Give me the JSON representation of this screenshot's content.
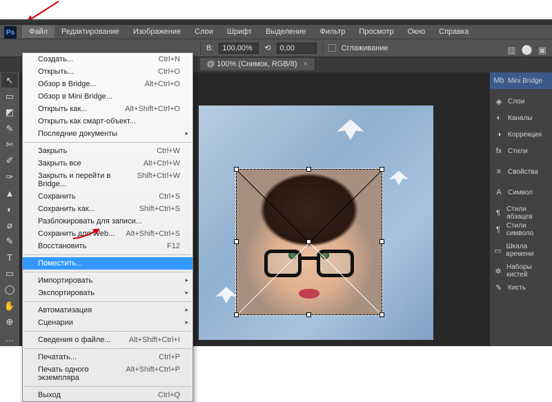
{
  "app_logo": "Ps",
  "menubar": [
    "Файл",
    "Редактирование",
    "Изображение",
    "Слои",
    "Шрифт",
    "Выделение",
    "Фильтр",
    "Просмотр",
    "Окно",
    "Справка"
  ],
  "options": {
    "w_label": "В:",
    "w_value": "100,00%",
    "h_value": "0,00",
    "rot_icon": "⟲",
    "aa_label": "Сглаживание"
  },
  "doc_tab": "@ 100% (Снимок, RGB/8)",
  "dropdown": {
    "groups": [
      [
        {
          "label": "Создать...",
          "shortcut": "Ctrl+N"
        },
        {
          "label": "Открыть...",
          "shortcut": "Ctrl+O"
        },
        {
          "label": "Обзор в Bridge...",
          "shortcut": "Alt+Ctrl+O"
        },
        {
          "label": "Обзор в Mini Bridge..."
        },
        {
          "label": "Открыть как...",
          "shortcut": "Alt+Shift+Ctrl+O"
        },
        {
          "label": "Открыть как смарт-объект..."
        },
        {
          "label": "Последние документы",
          "sub": true
        }
      ],
      [
        {
          "label": "Закрыть",
          "shortcut": "Ctrl+W"
        },
        {
          "label": "Закрыть все",
          "shortcut": "Alt+Ctrl+W"
        },
        {
          "label": "Закрыть и перейти в Bridge...",
          "shortcut": "Shift+Ctrl+W"
        },
        {
          "label": "Сохранить",
          "shortcut": "Ctrl+S"
        },
        {
          "label": "Сохранить как...",
          "shortcut": "Shift+Ctrl+S"
        },
        {
          "label": "Разблокировать для записи..."
        },
        {
          "label": "Сохранить для Web...",
          "shortcut": "Alt+Shift+Ctrl+S"
        },
        {
          "label": "Восстановить",
          "shortcut": "F12"
        }
      ],
      [
        {
          "label": "Поместить...",
          "hilite": true
        }
      ],
      [
        {
          "label": "Импортировать",
          "sub": true
        },
        {
          "label": "Экспортировать",
          "sub": true
        }
      ],
      [
        {
          "label": "Автоматизация",
          "sub": true
        },
        {
          "label": "Сценарии",
          "sub": true
        }
      ],
      [
        {
          "label": "Сведения о файле...",
          "shortcut": "Alt+Shift+Ctrl+I"
        }
      ],
      [
        {
          "label": "Печатать...",
          "shortcut": "Ctrl+P"
        },
        {
          "label": "Печать одного экземпляра",
          "shortcut": "Alt+Shift+Ctrl+P"
        }
      ],
      [
        {
          "label": "Выход",
          "shortcut": "Ctrl+Q"
        }
      ]
    ]
  },
  "panels": [
    {
      "icon": "Mb",
      "label": "Mini Bridge",
      "hl": true
    },
    {
      "sep": true
    },
    {
      "icon": "◈",
      "label": "Слои"
    },
    {
      "icon": "◐",
      "label": "Каналы"
    },
    {
      "icon": "◑",
      "label": "Коррекция"
    },
    {
      "icon": "fx",
      "label": "Стили"
    },
    {
      "sep": true
    },
    {
      "icon": "≡",
      "label": "Свойства"
    },
    {
      "sep": true
    },
    {
      "icon": "A",
      "label": "Символ"
    },
    {
      "sep": true
    },
    {
      "icon": "¶",
      "label": "Стили абзацев"
    },
    {
      "icon": "¶",
      "label": "Стили символо"
    },
    {
      "sep": true
    },
    {
      "icon": "▭",
      "label": "Шкала времени"
    },
    {
      "sep": true
    },
    {
      "icon": "✲",
      "label": "Наборы кистей"
    },
    {
      "icon": "✎",
      "label": "Кисть"
    }
  ],
  "tools": [
    "↖",
    "▭",
    "◩",
    "✎",
    "✄",
    "✐",
    "✑",
    "▲",
    "◐",
    "⌀",
    "✎",
    "T",
    "▭",
    "◯",
    "✋",
    "⊕",
    "…"
  ]
}
